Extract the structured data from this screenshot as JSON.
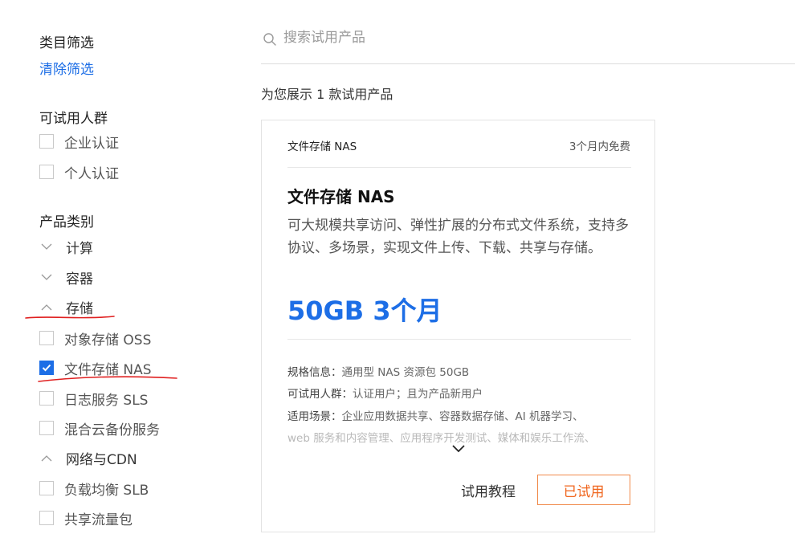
{
  "sidebar": {
    "filter_title": "类目筛选",
    "clear_label": "清除筛选",
    "audience": {
      "title": "可试用人群",
      "options": [
        {
          "label": "企业认证",
          "checked": false
        },
        {
          "label": "个人认证",
          "checked": false
        }
      ]
    },
    "category": {
      "title": "产品类别",
      "groups": [
        {
          "label": "计算",
          "expanded": false
        },
        {
          "label": "容器",
          "expanded": false
        },
        {
          "label": "存储",
          "expanded": true
        },
        {
          "label": "网络与CDN",
          "expanded": true
        }
      ],
      "storage_items": [
        {
          "label": "对象存储 OSS",
          "checked": false
        },
        {
          "label": "文件存储 NAS",
          "checked": true
        },
        {
          "label": "日志服务 SLS",
          "checked": false
        },
        {
          "label": "混合云备份服务",
          "checked": false
        }
      ],
      "network_items": [
        {
          "label": "负载均衡 SLB",
          "checked": false
        },
        {
          "label": "共享流量包",
          "checked": false
        }
      ]
    },
    "annotation_color": "#e02020"
  },
  "search": {
    "placeholder": "搜索试用产品",
    "value": ""
  },
  "results": {
    "count_text": "为您展示 1 款试用产品"
  },
  "card": {
    "header_name": "文件存储 NAS",
    "header_tag": "3个月内免费",
    "title": "文件存储 NAS",
    "description": "可大规模共享访问、弹性扩展的分布式文件系统，支持多协议、多场景，实现文件上传、下载、共享与存储。",
    "price": "50GB 3个月",
    "spec_label": "规格信息：",
    "spec_value": "通用型 NAS 资源包 50GB",
    "audience_label": "可试用人群：",
    "audience_value": "认证用户；且为产品新用户",
    "scene_label": "适用场景：",
    "scene_value_line1": "企业应用数据共享、容器数据存储、AI 机器学习、",
    "scene_value_line2": "web 服务和内容管理、应用程序开发测试、媒体和娱乐工作流、",
    "tutorial_label": "试用教程",
    "tried_label": "已试用"
  },
  "colors": {
    "accent": "#1d6ee6",
    "tried_button": "#f0661e",
    "annotation": "#e02020"
  }
}
